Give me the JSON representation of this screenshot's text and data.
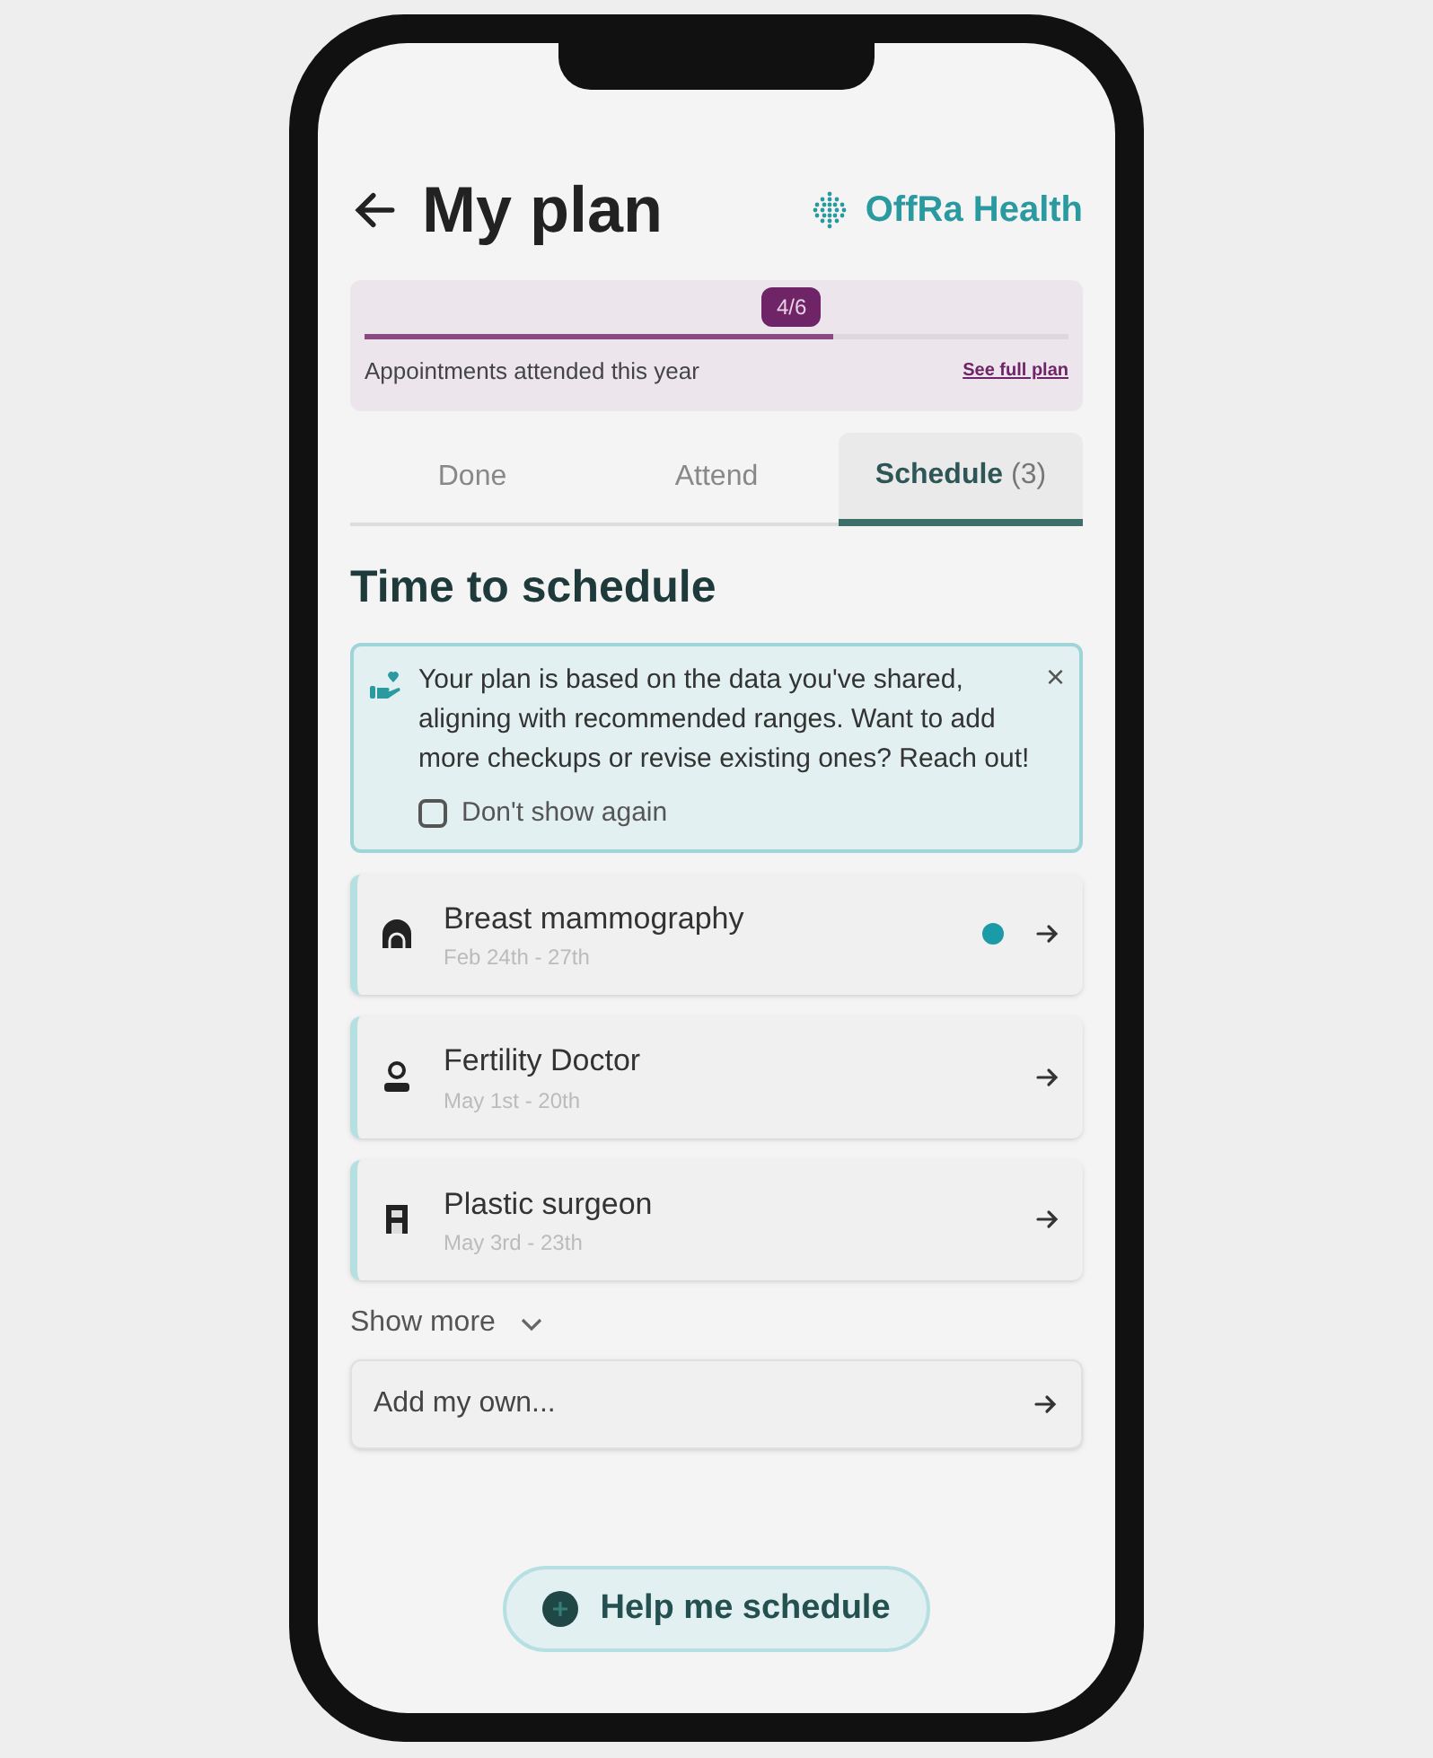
{
  "header": {
    "title": "My plan",
    "brand": "OffRa Health"
  },
  "progress": {
    "badge": "4/6",
    "level": 0.667,
    "label": "Appointments attended this year",
    "link": "See full plan"
  },
  "tabs": [
    {
      "label": "Done",
      "selected": false
    },
    {
      "label": "Attend",
      "selected": false
    },
    {
      "label": "Schedule",
      "count": "(3)",
      "selected": true
    }
  ],
  "section_title": "Time to schedule",
  "notice": {
    "text": "Your plan is based on the data you've shared, aligning with recommended ranges. Want to add more checkups or revise existing ones? Reach out!",
    "close": "×",
    "checkbox": {
      "label": "Don't show again",
      "checked": false
    }
  },
  "appointments": [
    {
      "kind": "mammography",
      "name": "Breast mammography",
      "dates": "Feb 24th - 27th",
      "badge": true
    },
    {
      "kind": "doctor",
      "name": "Fertility Doctor",
      "dates": "May 1st - 20th",
      "badge": false
    },
    {
      "kind": "clinic",
      "name": "Plastic surgeon",
      "dates": "May 3rd - 23th",
      "badge": false
    }
  ],
  "show_more": {
    "label": "Show more",
    "expanded": false
  },
  "add_field": {
    "placeholder": "Add my own..."
  },
  "help_button": {
    "label": "Help me schedule"
  }
}
